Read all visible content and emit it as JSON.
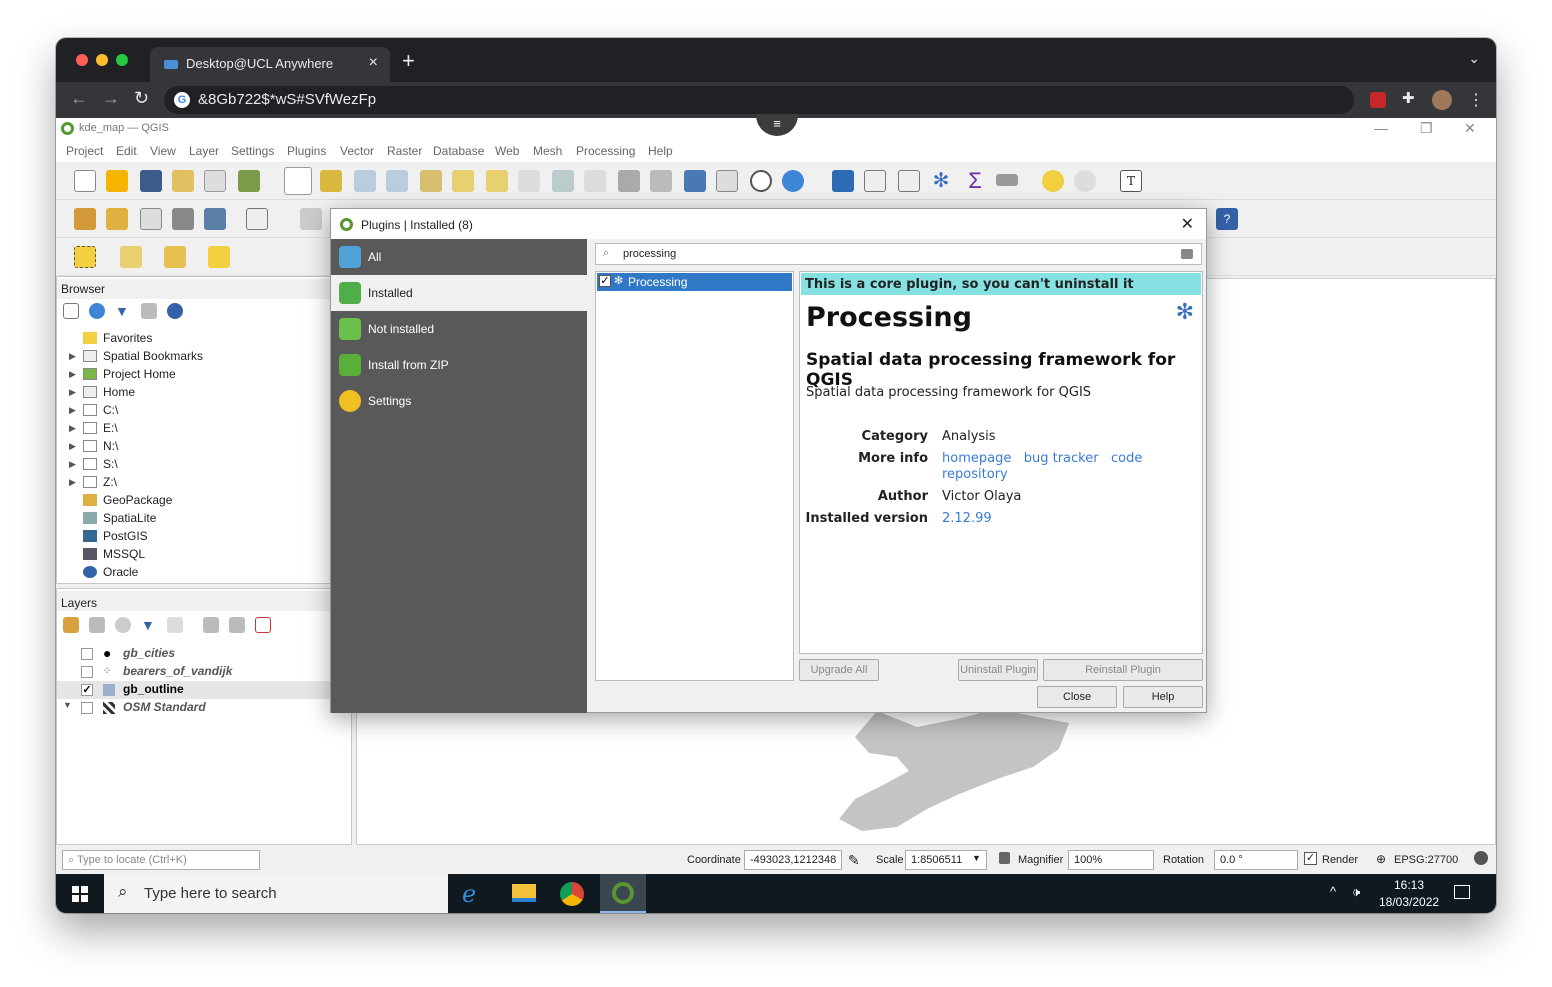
{
  "browser": {
    "tab_title": "Desktop@UCL Anywhere",
    "url": "&8Gb722$*wS#SVfWezFp"
  },
  "qgis": {
    "window_title": "kde_map — QGIS",
    "menu": [
      "Project",
      "Edit",
      "View",
      "Layer",
      "Settings",
      "Plugins",
      "Vector",
      "Raster",
      "Database",
      "Web",
      "Mesh",
      "Processing",
      "Help"
    ]
  },
  "browser_panel": {
    "title": "Browser",
    "items": [
      "Favorites",
      "Spatial Bookmarks",
      "Project Home",
      "Home",
      "C:\\",
      "E:\\",
      "N:\\",
      "S:\\",
      "Z:\\",
      "GeoPackage",
      "SpatiaLite",
      "PostGIS",
      "MSSQL",
      "Oracle"
    ]
  },
  "layers_panel": {
    "title": "Layers",
    "layers": [
      {
        "name": "gb_cities",
        "checked": false
      },
      {
        "name": "bearers_of_vandijk",
        "checked": false
      },
      {
        "name": "gb_outline",
        "checked": true
      },
      {
        "name": "OSM Standard",
        "checked": false
      }
    ]
  },
  "plugins_dialog": {
    "title": "Plugins | Installed (8)",
    "sidebar": [
      "All",
      "Installed",
      "Not installed",
      "Install from ZIP",
      "Settings"
    ],
    "search_value": "processing",
    "list_item": "Processing",
    "banner": "This is a core plugin, so you can't uninstall it",
    "heading": "Processing",
    "subheading": "Spatial data processing framework for QGIS",
    "description": "Spatial data processing framework for QGIS",
    "labels": {
      "category": "Category",
      "more_info": "More info",
      "author": "Author",
      "version": "Installed version"
    },
    "category": "Analysis",
    "links": [
      "homepage",
      "bug tracker",
      "code repository"
    ],
    "author": "Victor Olaya",
    "installed_version": "2.12.99",
    "buttons": {
      "upgrade_all": "Upgrade All",
      "uninstall": "Uninstall Plugin",
      "reinstall": "Reinstall Plugin",
      "close": "Close",
      "help": "Help"
    }
  },
  "statusbar": {
    "locate_placeholder": "Type to locate (Ctrl+K)",
    "coordinate_label": "Coordinate",
    "coordinate_value": "-493023,1212348",
    "scale_label": "Scale",
    "scale_value": "1:8506511",
    "magnifier_label": "Magnifier",
    "magnifier_value": "100%",
    "rotation_label": "Rotation",
    "rotation_value": "0.0 °",
    "render_label": "Render",
    "crs": "EPSG:27700"
  },
  "taskbar": {
    "search_placeholder": "Type here to search",
    "time": "16:13",
    "date": "18/03/2022"
  }
}
